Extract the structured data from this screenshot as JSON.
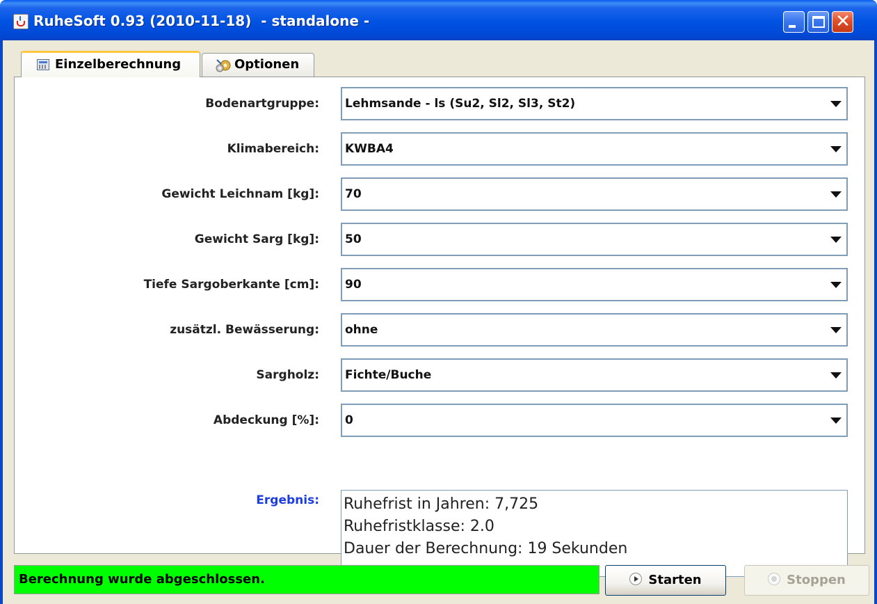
{
  "window": {
    "title": "RuheSoft 0.93 (2010-11-18)  - standalone -",
    "controls": {
      "minimize": "minimize-icon",
      "maximize": "maximize-icon",
      "close": "close-icon",
      "close_glyph": "✕"
    }
  },
  "tabs": [
    {
      "label": "Einzelberechnung",
      "icon": "calculator-icon",
      "active": true
    },
    {
      "label": "Optionen",
      "icon": "settings-gears-icon",
      "active": false
    }
  ],
  "form": {
    "fields": [
      {
        "label": "Bodenartgruppe:",
        "value": "Lehmsande - ls (Su2, Sl2, Sl3, St2)"
      },
      {
        "label": "Klimabereich:",
        "value": "KWBA4"
      },
      {
        "label": "Gewicht Leichnam [kg]:",
        "value": "70"
      },
      {
        "label": "Gewicht Sarg [kg]:",
        "value": "50"
      },
      {
        "label": "Tiefe Sargoberkante [cm]:",
        "value": "90"
      },
      {
        "label": "zusätzl. Bewässerung:",
        "value": "ohne"
      },
      {
        "label": "Sargholz:",
        "value": "Fichte/Buche"
      },
      {
        "label": "Abdeckung [%]:",
        "value": "0"
      }
    ],
    "result_label": "Ergebnis:",
    "result_lines": [
      "Ruhefrist in Jahren: 7,725",
      "Ruhefristklasse: 2.0",
      "Dauer der Berechnung: 19 Sekunden"
    ]
  },
  "footer": {
    "status": "Berechnung wurde abgeschlossen.",
    "status_color": "#00ff00",
    "start_label": "Starten",
    "stop_label": "Stoppen",
    "stop_enabled": false
  }
}
